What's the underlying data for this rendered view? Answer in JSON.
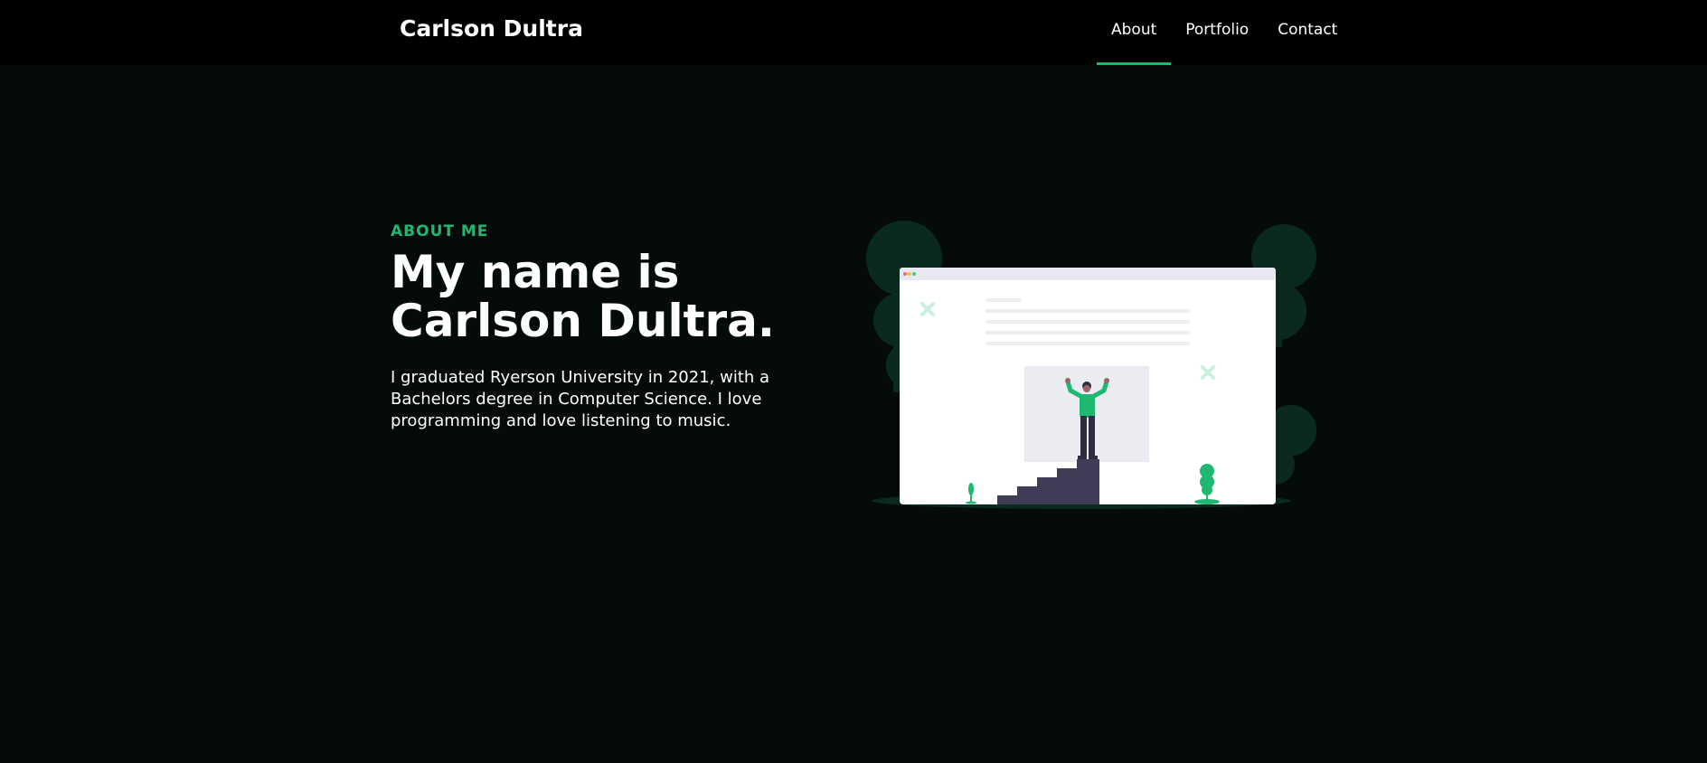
{
  "navbar": {
    "brand": "Carlson Dultra",
    "links": [
      {
        "label": "About",
        "active": true
      },
      {
        "label": "Portfolio",
        "active": false
      },
      {
        "label": "Contact",
        "active": false
      }
    ]
  },
  "about": {
    "eyebrow": "ABOUT ME",
    "heading_line1": "My name is",
    "heading_line2": "Carlson Dultra.",
    "bio": "I graduated Ryerson University in 2021, with a Bachelors degree in Computer Science. I love programming and love listening to music."
  },
  "colors": {
    "accent": "#1fb871",
    "background": "#050a0b",
    "navbar": "#000000",
    "foliage": "#0a2a1f"
  },
  "illustration": {
    "icon": "person-climbing-stairs-browser-illustration"
  }
}
